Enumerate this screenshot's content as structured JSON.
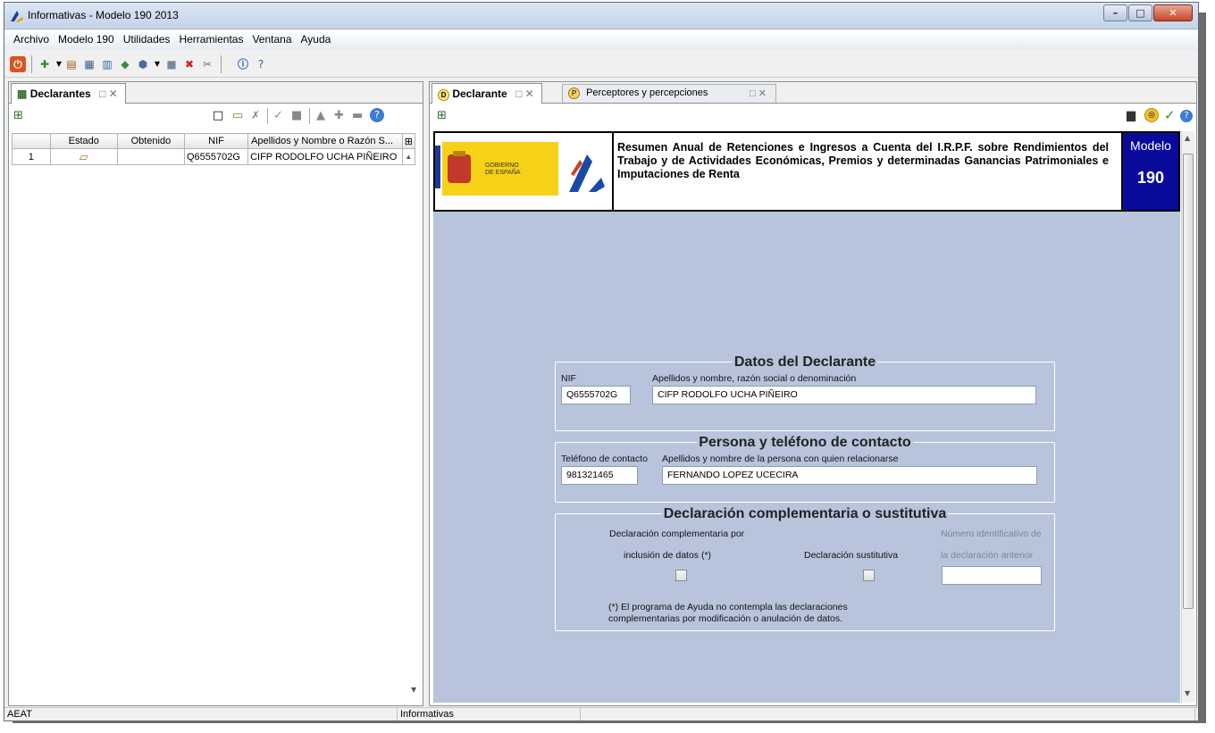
{
  "window": {
    "title": "Informativas - Modelo 190 2013"
  },
  "menu": [
    "Archivo",
    "Modelo 190",
    "Utilidades",
    "Herramientas",
    "Ventana",
    "Ayuda"
  ],
  "left_panel": {
    "tab_label": "Declarantes",
    "columns": [
      "",
      "Estado",
      "Obtenido",
      "NIF",
      "Apellidos y Nombre o Razón S..."
    ],
    "rows": [
      {
        "num": "1",
        "estado": "folder-open-icon",
        "obtenido": "",
        "nif": "Q6555702G",
        "nombre": "CIFP RODOLFO UCHA PIÑEIRO"
      }
    ]
  },
  "right_panel": {
    "tabs": [
      {
        "label": "Declarante",
        "active": true
      },
      {
        "label": "Perceptores y percepciones",
        "active": false
      }
    ],
    "header": {
      "logo_text": "GOBIERNO DE ESPAÑA",
      "title": "Resumen Anual de Retenciones e Ingresos a Cuenta del I.R.P.F. sobre Rendimientos del Trabajo y de Actividades Económicas, Premios y determinadas Ganancias Patrimoniales e Imputaciones de Renta",
      "modelo_label": "Modelo",
      "modelo_num": "190"
    },
    "datos_declarante": {
      "title": "Datos del Declarante",
      "nif_label": "NIF",
      "nif_value": "Q6555702G",
      "nombre_label": "Apellidos y nombre, razón social o denominación",
      "nombre_value": "CIFP RODOLFO UCHA PIÑEIRO"
    },
    "persona_contacto": {
      "title": "Persona y teléfono de contacto",
      "telefono_label": "Teléfono de contacto",
      "telefono_value": "981321465",
      "persona_label": "Apellidos y nombre de la persona con quien relacionarse",
      "persona_value": "FERNANDO LOPEZ UCECIRA"
    },
    "complementaria": {
      "title": "Declaración complementaria o sustitutiva",
      "comp_label_1": "Declaración complementaria por",
      "comp_label_2": "inclusión de datos (*)",
      "sust_label": "Declaración sustitutiva",
      "num_label_1": "Número identificativo de",
      "num_label_2": "la declaración anterior",
      "num_value": "",
      "note_1": "(*) El programa de Ayuda no contempla las declaraciones",
      "note_2": "complementarias por modificación o anulación de datos."
    }
  },
  "status": {
    "left": "AEAT",
    "middle": "Informativas"
  },
  "colors": {
    "form_bg": "#b8c4dc",
    "modelo_bg": "#0a0a9a"
  }
}
